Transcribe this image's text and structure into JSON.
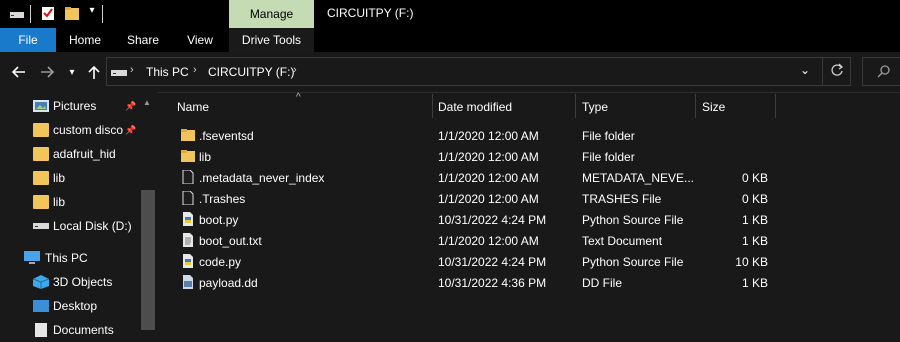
{
  "window": {
    "title": "CIRCUITPY (F:)",
    "context_tab": "Manage",
    "context_subtab": "Drive Tools"
  },
  "ribbon_tabs": [
    "File",
    "Home",
    "Share",
    "View"
  ],
  "address": {
    "crumbs": [
      "This PC",
      "CIRCUITPY (F:)"
    ]
  },
  "sidebar": {
    "items": [
      {
        "label": "Pictures",
        "icon": "pictures-icon",
        "pinned": true
      },
      {
        "label": "custom disco",
        "icon": "folder-icon",
        "pinned": true
      },
      {
        "label": "adafruit_hid",
        "icon": "folder-icon",
        "pinned": false
      },
      {
        "label": "lib",
        "icon": "folder-icon",
        "pinned": false
      },
      {
        "label": "lib",
        "icon": "folder-icon",
        "pinned": false
      },
      {
        "label": "Local Disk (D:)",
        "icon": "drive-icon",
        "pinned": false
      },
      {
        "label": "This PC",
        "icon": "computer-icon",
        "pinned": false
      },
      {
        "label": "3D Objects",
        "icon": "3d-objects-icon",
        "pinned": false
      },
      {
        "label": "Desktop",
        "icon": "desktop-icon",
        "pinned": false
      },
      {
        "label": "Documents",
        "icon": "documents-icon",
        "pinned": false
      }
    ]
  },
  "columns": {
    "name": "Name",
    "date": "Date modified",
    "type": "Type",
    "size": "Size"
  },
  "files": [
    {
      "name": ".fseventsd",
      "date": "1/1/2020 12:00 AM",
      "type": "File folder",
      "size": "",
      "icon": "folder-icon"
    },
    {
      "name": "lib",
      "date": "1/1/2020 12:00 AM",
      "type": "File folder",
      "size": "",
      "icon": "folder-icon"
    },
    {
      "name": ".metadata_never_index",
      "date": "1/1/2020 12:00 AM",
      "type": "METADATA_NEVE...",
      "size": "0 KB",
      "icon": "blank-file-icon"
    },
    {
      "name": ".Trashes",
      "date": "1/1/2020 12:00 AM",
      "type": "TRASHES File",
      "size": "0 KB",
      "icon": "blank-file-icon"
    },
    {
      "name": "boot.py",
      "date": "10/31/2022 4:24 PM",
      "type": "Python Source File",
      "size": "1 KB",
      "icon": "python-file-icon"
    },
    {
      "name": "boot_out.txt",
      "date": "1/1/2020 12:00 AM",
      "type": "Text Document",
      "size": "1 KB",
      "icon": "text-file-icon"
    },
    {
      "name": "code.py",
      "date": "10/31/2022 4:24 PM",
      "type": "Python Source File",
      "size": "10 KB",
      "icon": "python-file-icon"
    },
    {
      "name": "payload.dd",
      "date": "10/31/2022 4:36 PM",
      "type": "DD File",
      "size": "1 KB",
      "icon": "dd-file-icon"
    }
  ],
  "colors": {
    "accent": "#1979ca",
    "manage_tab": "#c4dbb4",
    "background": "#191919",
    "folder": "#f2c55c"
  }
}
